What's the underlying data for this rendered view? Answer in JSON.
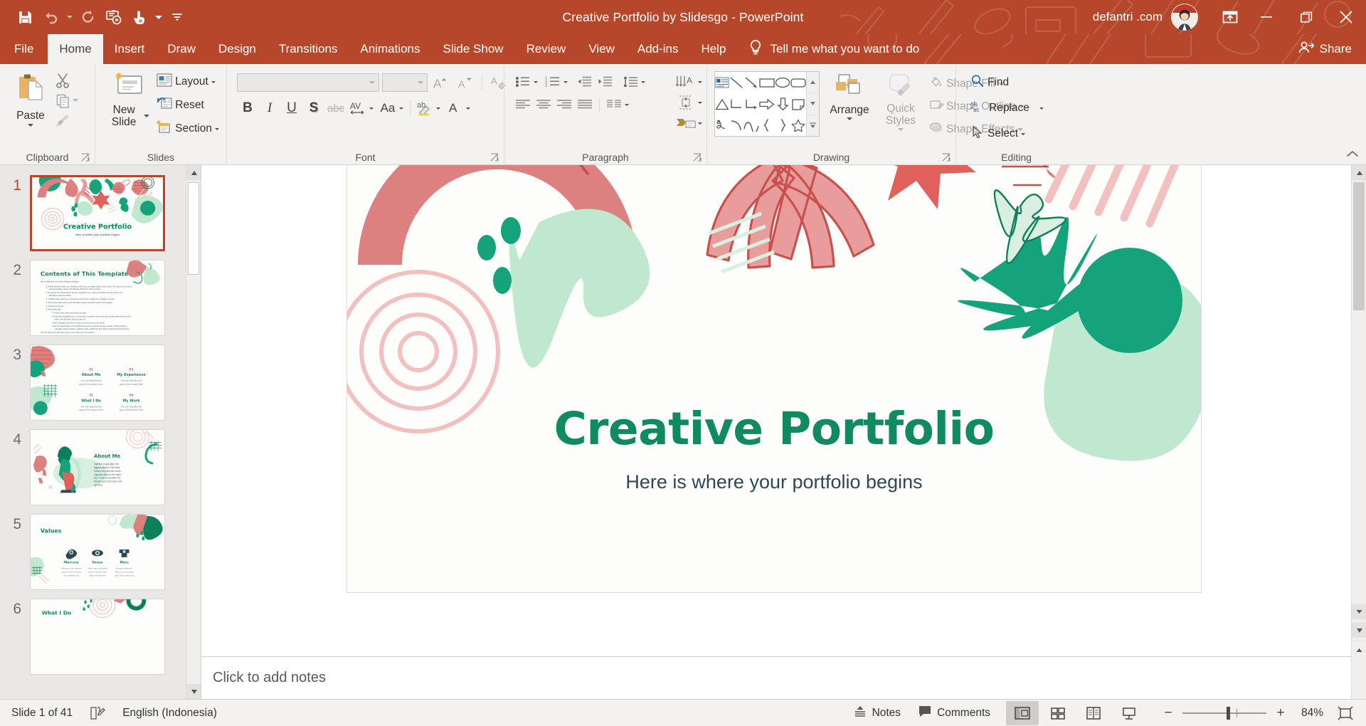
{
  "titlebar": {
    "document_title": "Creative Portfolio by Slidesgo  -  PowerPoint",
    "account_name": "defantri .com",
    "quick_access": [
      {
        "name": "save-icon",
        "label": "Save"
      },
      {
        "name": "undo-icon",
        "label": "Undo"
      },
      {
        "name": "redo-icon",
        "label": "Redo"
      },
      {
        "name": "start-from-beginning-icon",
        "label": "Start From Beginning"
      },
      {
        "name": "touch-mouse-mode-icon",
        "label": "Touch/Mouse Mode"
      },
      {
        "name": "customize-quick-access-icon",
        "label": "Customize Quick Access Toolbar"
      }
    ],
    "window_controls": {
      "ribbon_display": "Ribbon Display Options",
      "minimize": "Minimize",
      "restore": "Restore Down",
      "close": "Close"
    }
  },
  "tabs": [
    {
      "label": "File",
      "active": false
    },
    {
      "label": "Home",
      "active": true
    },
    {
      "label": "Insert",
      "active": false
    },
    {
      "label": "Draw",
      "active": false
    },
    {
      "label": "Design",
      "active": false
    },
    {
      "label": "Transitions",
      "active": false
    },
    {
      "label": "Animations",
      "active": false
    },
    {
      "label": "Slide Show",
      "active": false
    },
    {
      "label": "Review",
      "active": false
    },
    {
      "label": "View",
      "active": false
    },
    {
      "label": "Add-ins",
      "active": false
    },
    {
      "label": "Help",
      "active": false
    }
  ],
  "tellme": {
    "label": "Tell me what you want to do",
    "icon": "lightbulb-icon"
  },
  "share": {
    "label": "Share",
    "icon": "share-person-icon"
  },
  "ribbon": {
    "groups": {
      "clipboard": {
        "label": "Clipboard",
        "paste_label": "Paste",
        "cut_label": "Cut",
        "copy_label": "Copy",
        "format_painter_label": "Format Painter"
      },
      "slides": {
        "label": "Slides",
        "new_slide_label": "New Slide",
        "layout_label": "Layout",
        "reset_label": "Reset",
        "section_label": "Section"
      },
      "font": {
        "label": "Font",
        "font_name_value": "",
        "font_name_placeholder": "",
        "font_size_value": "",
        "font_size_placeholder": "",
        "increase_font_label": "Increase Font Size",
        "decrease_font_label": "Decrease Font Size",
        "clear_formatting_label": "Clear All Formatting",
        "bold_label": "B",
        "italic_label": "I",
        "underline_label": "U",
        "shadow_label": "S",
        "strikethrough_label": "abc",
        "character_spacing_label": "AV",
        "change_case_label": "Aa",
        "text_highlight_label": "Text Highlight Color",
        "font_color_label": "A"
      },
      "paragraph": {
        "label": "Paragraph",
        "bullets_label": "Bullets",
        "numbering_label": "Numbering",
        "decrease_indent_label": "Decrease List Level",
        "increase_indent_label": "Increase List Level",
        "line_spacing_label": "Line Spacing",
        "text_direction_label": "Text Direction",
        "align_text_label": "Align Text",
        "convert_smartart_label": "Convert to SmartArt",
        "align_left_label": "Align Left",
        "align_center_label": "Center",
        "align_right_label": "Align Right",
        "justify_label": "Justify",
        "columns_label": "Add or Remove Columns"
      },
      "drawing": {
        "label": "Drawing",
        "arrange_label": "Arrange",
        "quick_styles_label": "Quick Styles",
        "shape_fill_label": "Shape Fill",
        "shape_outline_label": "Shape Outline",
        "shape_effects_label": "Shape Effects",
        "shapes": [
          "text-box-shape",
          "line-shape",
          "arrow-shape",
          "rectangle-shape",
          "oval-shape",
          "rounded-rectangle-shape",
          "triangle-shape",
          "elbow-connector-shape",
          "elbow-arrow-connector-shape",
          "right-arrow-shape",
          "down-arrow-shape",
          "folded-corner-shape",
          "scribble-shape",
          "arc-shape",
          "curve-shape",
          "left-brace-shape",
          "right-brace-shape",
          "star-shape"
        ]
      },
      "editing": {
        "label": "Editing",
        "find_label": "Find",
        "replace_label": "Replace",
        "select_label": "Select"
      }
    },
    "collapse_label": "Collapse the Ribbon"
  },
  "thumbnails": [
    {
      "number": "1",
      "selected": true,
      "kind": "title",
      "title": "Creative Portfolio",
      "subtitle": "Here is where your portfolio begins"
    },
    {
      "number": "2",
      "selected": false,
      "kind": "contents",
      "title": "Contents of This Template",
      "subtitle": ""
    },
    {
      "number": "3",
      "selected": false,
      "kind": "sections",
      "title": "",
      "subtitle": "",
      "items": [
        {
          "num": "01",
          "name": "About Me",
          "desc": "You can describe the topic of the section here"
        },
        {
          "num": "03",
          "name": "My Experience",
          "desc": "You can describe the topic of the section here"
        },
        {
          "num": "02",
          "name": "What I Do",
          "desc": "You can describe the topic of the section here"
        },
        {
          "num": "04",
          "name": "My Work",
          "desc": "You can describe the topic of the section here"
        }
      ]
    },
    {
      "number": "4",
      "selected": false,
      "kind": "aboutme",
      "title": "About Me",
      "body": "Jupiter is a gas giant, the biggest planet in the Solar System and also the fourth-brightest object in the night sky. It was named after the Roman god of the skies and lightning"
    },
    {
      "number": "5",
      "selected": false,
      "kind": "values",
      "title": "Values",
      "items": [
        {
          "name": "Mercury",
          "desc": "Mercury is the closest planet to the Sun and the smallest one"
        },
        {
          "name": "Venus",
          "desc": "Venus has a beautiful name, but also very high temperatures"
        },
        {
          "name": "Mars",
          "desc": "Despite being red, Mars is a cold place full of iron oxide dust"
        }
      ]
    },
    {
      "number": "6",
      "selected": false,
      "kind": "whatido",
      "title": "What I Do",
      "subtitle": ""
    }
  ],
  "slide": {
    "title": "Creative Portfolio",
    "subtitle": "Here is where your portfolio begins",
    "colors": {
      "title_green": "#108a5f",
      "subtitle_blue": "#2e4756",
      "teal": "#14a37b",
      "dark_teal": "#0d7f5b",
      "coral": "#dd8180",
      "coral_line": "#c9504c",
      "pink": "#f2c0be",
      "mint": "#bfe8ce",
      "background": "#fdfdfc"
    }
  },
  "notes": {
    "placeholder": "Click to add notes"
  },
  "statusbar": {
    "slide_counter": "Slide 1 of 41",
    "accessibility_icon": "spell-check-icon",
    "language": "English (Indonesia)",
    "notes_label": "Notes",
    "comments_label": "Comments",
    "views": [
      {
        "name": "normal-view",
        "label": "Normal",
        "active": true
      },
      {
        "name": "slide-sorter-view",
        "label": "Slide Sorter",
        "active": false
      },
      {
        "name": "reading-view",
        "label": "Reading View",
        "active": false
      },
      {
        "name": "slide-show-view",
        "label": "Slide Show",
        "active": false
      }
    ],
    "zoom_out_label": "Zoom Out",
    "zoom_in_label": "Zoom In",
    "zoom_value": "84%",
    "fit_label": "Fit slide to current window"
  }
}
